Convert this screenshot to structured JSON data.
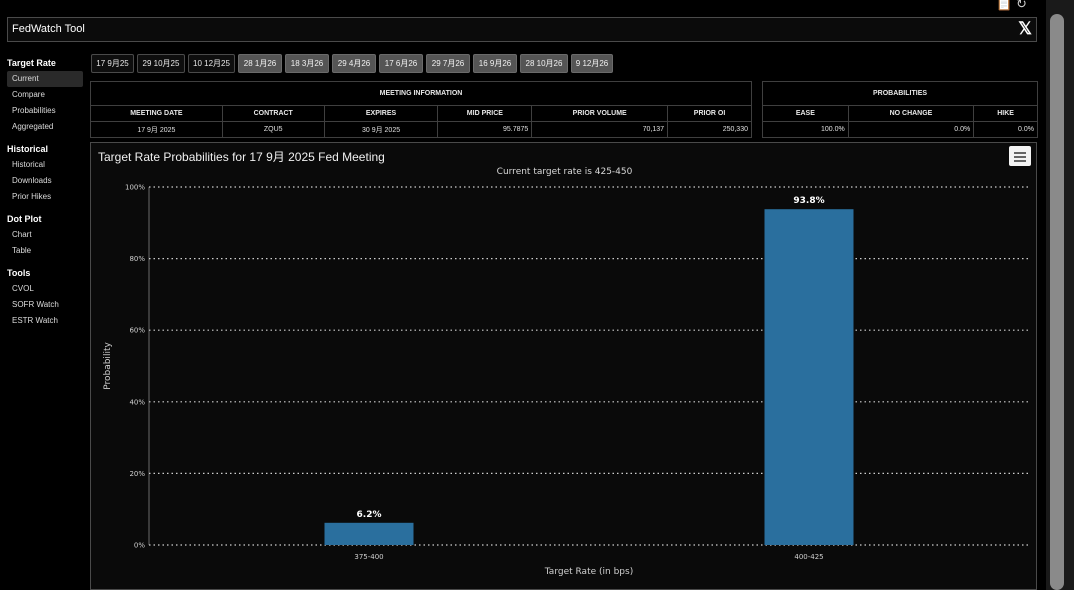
{
  "app": {
    "title": "FedWatch Tool",
    "x_logo": "𝕏"
  },
  "top_icons": [
    "paste-icon",
    "refresh-icon"
  ],
  "sidebar": {
    "sections": [
      {
        "heading": "Target Rate",
        "items": [
          {
            "label": "Current",
            "active": true
          },
          {
            "label": "Compare"
          },
          {
            "label": "Probabilities"
          },
          {
            "label": "Aggregated"
          }
        ]
      },
      {
        "heading": "Historical",
        "items": [
          {
            "label": "Historical"
          },
          {
            "label": "Downloads"
          },
          {
            "label": "Prior Hikes"
          }
        ]
      },
      {
        "heading": "Dot Plot",
        "items": [
          {
            "label": "Chart"
          },
          {
            "label": "Table"
          }
        ]
      },
      {
        "heading": "Tools",
        "items": [
          {
            "label": "CVOL"
          },
          {
            "label": "SOFR Watch"
          },
          {
            "label": "ESTR Watch"
          }
        ]
      }
    ]
  },
  "date_tabs": [
    {
      "label": "17 9月25",
      "future": false
    },
    {
      "label": "29 10月25",
      "future": false
    },
    {
      "label": "10 12月25",
      "future": false
    },
    {
      "label": "28 1月26",
      "future": true
    },
    {
      "label": "18 3月26",
      "future": true
    },
    {
      "label": "29 4月26",
      "future": true
    },
    {
      "label": "17 6月26",
      "future": true
    },
    {
      "label": "29 7月26",
      "future": true
    },
    {
      "label": "16 9月26",
      "future": true
    },
    {
      "label": "28 10月26",
      "future": true
    },
    {
      "label": "9 12月26",
      "future": true
    }
  ],
  "meeting_info": {
    "group_header": "MEETING INFORMATION",
    "columns": [
      "MEETING DATE",
      "CONTRACT",
      "EXPIRES",
      "MID PRICE",
      "PRIOR VOLUME",
      "PRIOR OI"
    ],
    "row": [
      "17 9月 2025",
      "ZQU5",
      "30 9月 2025",
      "95.7875",
      "70,137",
      "250,330"
    ]
  },
  "probabilities": {
    "group_header": "PROBABILITIES",
    "columns": [
      "EASE",
      "NO CHANGE",
      "HIKE"
    ],
    "row": [
      "100.0%",
      "0.0%",
      "0.0%"
    ]
  },
  "chart": {
    "title": "Target Rate Probabilities for 17 9月 2025 Fed Meeting",
    "subtitle": "Current target rate is 425-450",
    "menu_icon": "hamburger-icon"
  },
  "chart_data": {
    "type": "bar",
    "title": "Target Rate Probabilities for 17 9月 2025 Fed Meeting",
    "subtitle": "Current target rate is 425-450",
    "categories": [
      "375-400",
      "400-425"
    ],
    "values": [
      6.2,
      93.8
    ],
    "data_labels": [
      "6.2%",
      "93.8%"
    ],
    "xlabel": "Target Rate (in bps)",
    "ylabel": "Probability",
    "ylim": [
      0,
      100
    ],
    "yticks": [
      "0%",
      "20%",
      "40%",
      "60%",
      "80%",
      "100%"
    ],
    "grid": true,
    "bar_color": "#2a6f9e"
  }
}
